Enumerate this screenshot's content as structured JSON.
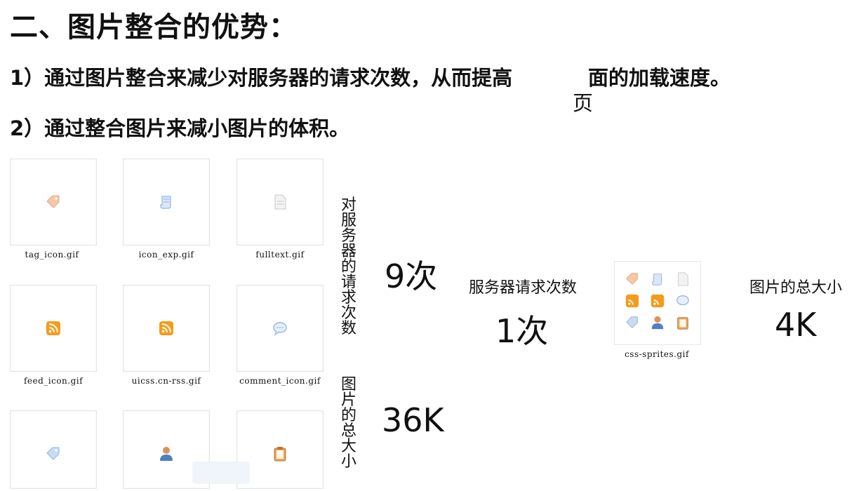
{
  "heading": "二、图片整合的优势：",
  "point1_a": "1）通过图片整合来减少对服务器的请求次数，从而提高",
  "point1_b": "面的加载速度。",
  "point1_ye": "页",
  "point2": "2）通过整合图片来减小图片的体积。",
  "files": [
    {
      "name": "tag_icon.gif",
      "icon": "tag-icon"
    },
    {
      "name": "icon_exp.gif",
      "icon": "scroll-icon"
    },
    {
      "name": "fulltext.gif",
      "icon": "document-icon"
    },
    {
      "name": "feed_icon.gif",
      "icon": "rss-icon"
    },
    {
      "name": "uicss.cn-rss.gif",
      "icon": "rss-icon"
    },
    {
      "name": "comment_icon.gif",
      "icon": "comment-icon"
    },
    {
      "name": "",
      "icon": "tag-icon"
    },
    {
      "name": "",
      "icon": "user-icon"
    },
    {
      "name": "",
      "icon": "clipboard-icon"
    }
  ],
  "vertical_requests": "对服务器的请求次数",
  "vertical_size": "图片的总大小",
  "requests_before": "9次",
  "size_before": "36K",
  "requests_label": "服务器请求次数",
  "requests_after": "1次",
  "sprite_name": "css-sprites.gif",
  "size_label": "图片的总大小",
  "size_after": "4K",
  "colors": {
    "rss": "#f59b1a",
    "tag": "#f4b78f",
    "blue": "#8fb5e3"
  }
}
